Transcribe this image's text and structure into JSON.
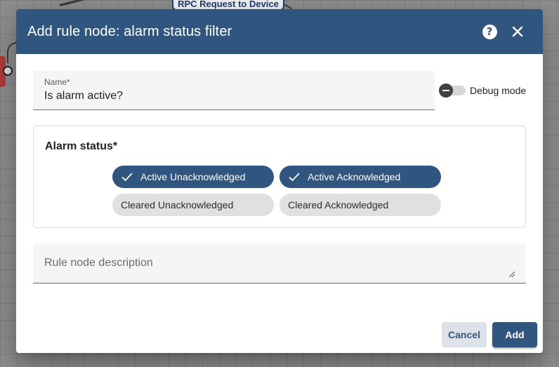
{
  "background": {
    "rpc_node_label": "RPC Request to Device"
  },
  "dialog": {
    "title": "Add rule node: alarm status filter",
    "help_icon": "help-icon",
    "close_icon": "close-icon"
  },
  "name_field": {
    "label": "Name*",
    "value": "Is alarm active?"
  },
  "debug_mode": {
    "label": "Debug mode",
    "enabled": false
  },
  "alarm_status": {
    "title": "Alarm status*",
    "chips": [
      {
        "label": "Active Unacknowledged",
        "selected": true
      },
      {
        "label": "Active Acknowledged",
        "selected": true
      },
      {
        "label": "Cleared Unacknowledged",
        "selected": false
      },
      {
        "label": "Cleared Acknowledged",
        "selected": false
      }
    ]
  },
  "description": {
    "placeholder": "Rule node description"
  },
  "actions": {
    "cancel_label": "Cancel",
    "add_label": "Add"
  },
  "colors": {
    "primary": "#305680",
    "chip_unselected": "#e0e0e0"
  }
}
